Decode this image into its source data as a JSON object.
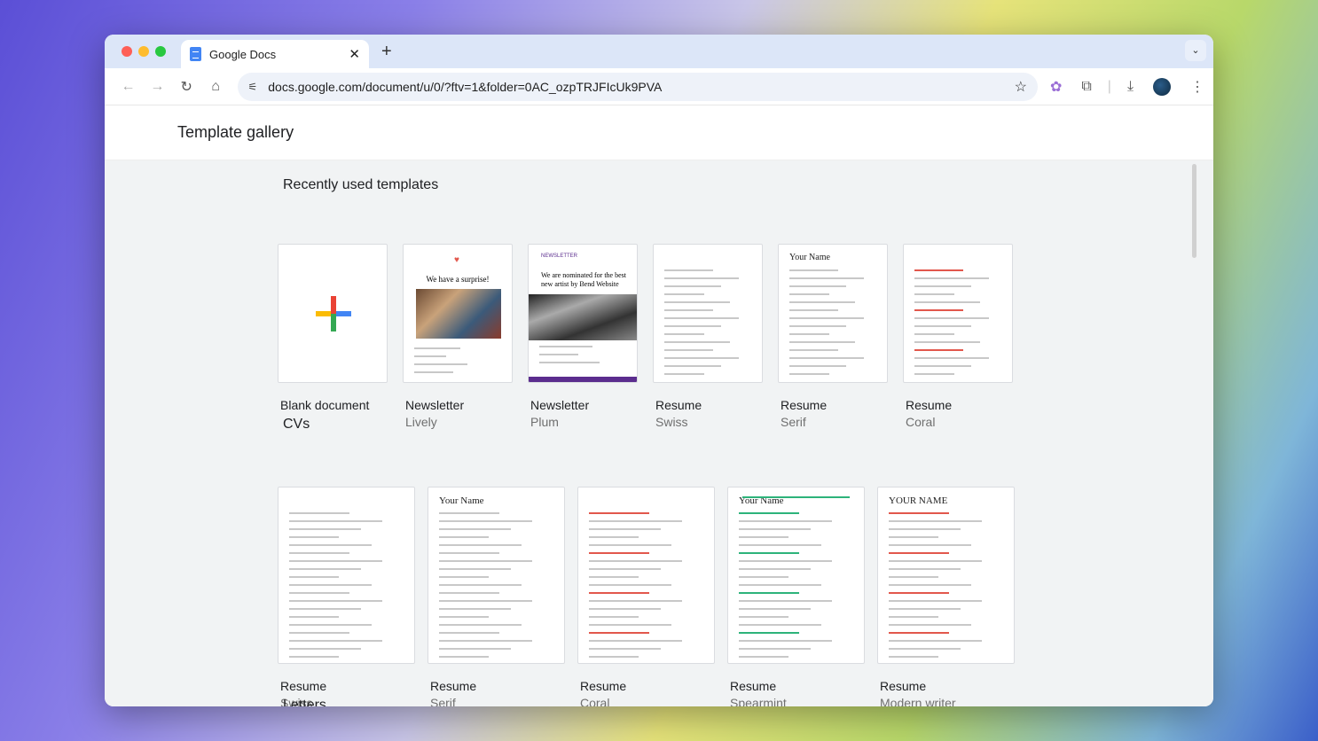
{
  "browser": {
    "tab_title": "Google Docs",
    "url": "docs.google.com/document/u/0/?ftv=1&folder=0AC_ozpTRJFIcUk9PVA"
  },
  "header": {
    "title": "Template gallery"
  },
  "recent": {
    "title": "Recently used templates",
    "items": [
      {
        "name": "Blank document",
        "sub": ""
      },
      {
        "name": "Newsletter",
        "sub": "Lively",
        "thumb_text": "We have a surprise!"
      },
      {
        "name": "Newsletter",
        "sub": "Plum",
        "thumb_text": "We are nominated for the best new artist by Bend Website"
      },
      {
        "name": "Resume",
        "sub": "Swiss"
      },
      {
        "name": "Resume",
        "sub": "Serif",
        "thumb_text": "Your Name"
      },
      {
        "name": "Resume",
        "sub": "Coral"
      }
    ]
  },
  "cvs": {
    "title": "CVs",
    "items": [
      {
        "name": "Resume",
        "sub": "Swiss"
      },
      {
        "name": "Resume",
        "sub": "Serif",
        "thumb_text": "Your Name"
      },
      {
        "name": "Resume",
        "sub": "Coral"
      },
      {
        "name": "Resume",
        "sub": "Spearmint",
        "thumb_text": "Your Name"
      },
      {
        "name": "Resume",
        "sub": "Modern writer",
        "thumb_text": "YOUR NAME"
      }
    ]
  },
  "letters": {
    "title": "Letters"
  },
  "colors": {
    "plum": "#5b2d8e",
    "coral": "#e2574c",
    "spearmint": "#2db37a"
  }
}
